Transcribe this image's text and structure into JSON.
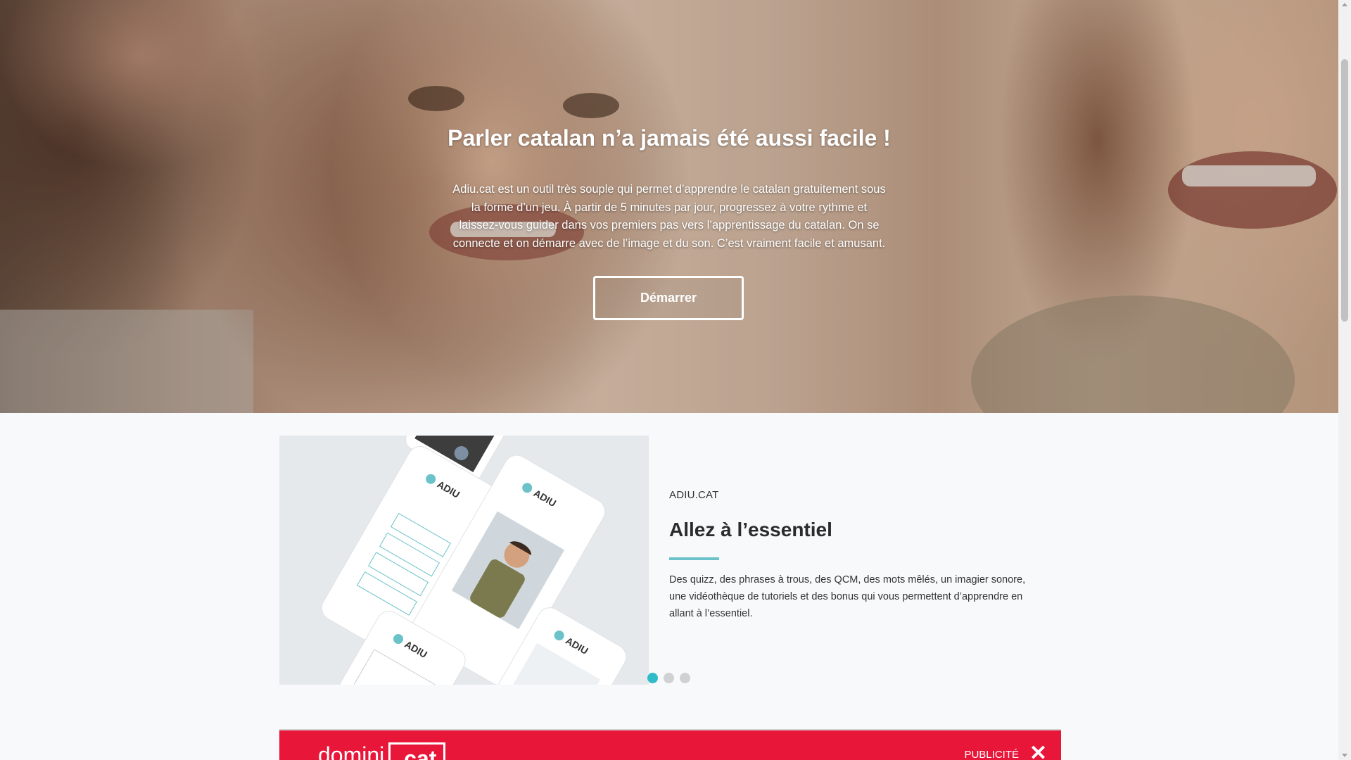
{
  "hero": {
    "title": "Parler catalan n’a jamais été aussi facile !",
    "text": "Adiu.cat est un outil très souple qui permet d’apprendre le catalan gratuitement sous la forme d’un jeu. À partir de 5 minutes par jour, progressez à votre rythme et laissez-vous guider dans vos premiers pas vers l’apprentissage du catalan. On se connecte et on démarre avec de l’image et du son. C’est vraiment facile et amusant.",
    "button_label": "Démarrer"
  },
  "feature": {
    "kicker": "ADIU.CAT",
    "title": "Allez à l’essentiel",
    "text": "Des quizz, des phrases à trous, des QCM, des mots mêlés, un imagier sonore, une vidéothèque de tutoriels et des bonus qui vous permettent d’apprendre en allant à l’essentiel.",
    "accent_color": "#6bc2c9",
    "phone_logo": "ADIU",
    "slider": {
      "count": 3,
      "active_index": 0,
      "active_color": "#2fbcc8"
    }
  },
  "ad": {
    "logo_part1": "domini",
    "logo_part2": ".cat",
    "label": "PUBLICITÉ",
    "close_glyph": "✕",
    "color": "#e8173a"
  },
  "icons": {
    "close": "close-icon",
    "scroll_up": "scroll-up-icon",
    "scroll_down": "scroll-down-icon"
  }
}
